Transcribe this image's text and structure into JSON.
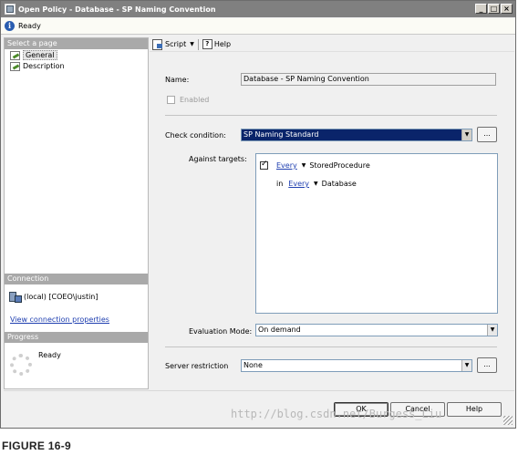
{
  "window": {
    "title": "Open Policy - Database - SP Naming Convention",
    "buttons": {
      "minimize": "_",
      "maximize": "□",
      "close": "×"
    }
  },
  "status": {
    "text": "Ready",
    "icon": "info-icon"
  },
  "left": {
    "select_page_header": "Select a page",
    "pages": [
      "General",
      "Description"
    ],
    "connection_header": "Connection",
    "connection_server": "(local) [COEO\\justin]",
    "connection_link": "View connection properties",
    "progress_header": "Progress",
    "progress_status": "Ready"
  },
  "toolbar": {
    "script_label": "Script",
    "help_label": "Help"
  },
  "form": {
    "name_label": "Name:",
    "name_value": "Database - SP Naming Convention",
    "enabled_label": "Enabled",
    "check_condition_label": "Check condition:",
    "check_condition_value": "SP Naming Standard",
    "against_targets_label": "Against targets:",
    "targets": [
      {
        "prefix": "",
        "selector": "Every",
        "object": "StoredProcedure"
      },
      {
        "prefix": "in",
        "selector": "Every",
        "object": "Database"
      }
    ],
    "evaluation_mode_label": "Evaluation Mode:",
    "evaluation_mode_value": "On demand",
    "server_restriction_label": "Server restriction",
    "server_restriction_value": "None",
    "ellipsis": "..."
  },
  "footer": {
    "ok": "OK",
    "cancel": "Cancel",
    "help": "Help"
  },
  "watermark": "http://blog.csdn.net/Burgess_Liu",
  "caption": "FIGURE 16-9"
}
